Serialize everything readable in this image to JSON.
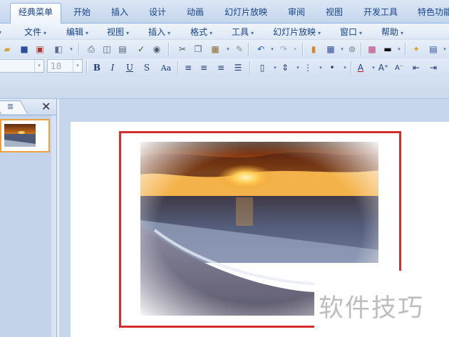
{
  "ribbon_tabs": [
    {
      "label": "经典菜单",
      "active": true
    },
    {
      "label": "开始",
      "active": false
    },
    {
      "label": "插入",
      "active": false
    },
    {
      "label": "设计",
      "active": false
    },
    {
      "label": "动画",
      "active": false
    },
    {
      "label": "幻灯片放映",
      "active": false
    },
    {
      "label": "审阅",
      "active": false
    },
    {
      "label": "视图",
      "active": false
    },
    {
      "label": "开发工具",
      "active": false
    },
    {
      "label": "特色功能",
      "active": false
    }
  ],
  "menu": {
    "items": [
      {
        "label": "文件"
      },
      {
        "label": "编辑"
      },
      {
        "label": "视图"
      },
      {
        "label": "插入"
      },
      {
        "label": "格式"
      },
      {
        "label": "工具"
      },
      {
        "label": "幻灯片放映"
      },
      {
        "label": "窗口"
      },
      {
        "label": "帮助"
      }
    ]
  },
  "format_bar": {
    "font_size": "18",
    "bold": "B",
    "italic": "I",
    "underline": "U",
    "shadow": "S",
    "case": "Aa"
  },
  "watermark": {
    "text": "软件技巧"
  },
  "colors": {
    "accent_red": "#d42d2d",
    "thumb_border": "#f0a13d",
    "ribbon_bg": "#c4d6ec"
  }
}
